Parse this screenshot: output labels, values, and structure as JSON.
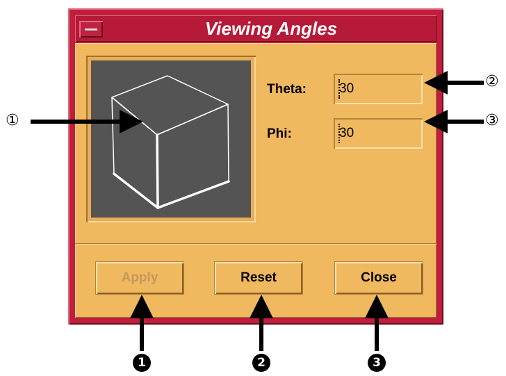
{
  "window": {
    "title": "Viewing Angles",
    "menu_button": "window-menu"
  },
  "fields": {
    "theta": {
      "label": "Theta:",
      "value": "30"
    },
    "phi": {
      "label": "Phi:",
      "value": "30"
    }
  },
  "buttons": {
    "apply": {
      "label": "Apply",
      "enabled": false
    },
    "reset": {
      "label": "Reset",
      "enabled": true
    },
    "close": {
      "label": "Close",
      "enabled": true
    }
  },
  "callouts": {
    "preview": "①",
    "theta": "②",
    "phi": "③",
    "apply": "1",
    "reset": "2",
    "close": "3"
  },
  "colors": {
    "frame": "#bf1f3c",
    "panel": "#f0b85f",
    "preview_bg": "#545454",
    "cube_line": "#ffffff"
  },
  "icons": {
    "preview": "cube-wireframe-icon",
    "menu": "window-menu-icon",
    "arrows": "arrow-icon"
  }
}
